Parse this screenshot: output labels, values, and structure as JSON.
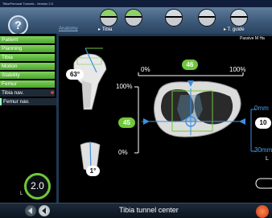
{
  "window_title": "Tibia/Femoral Tunnels - Version 2.0",
  "help_label": "?",
  "phases": [
    {
      "name": "phase-1-icon",
      "state": "done"
    },
    {
      "name": "phase-2-icon",
      "state": "done"
    },
    {
      "name": "phase-3-icon",
      "state": "pending"
    },
    {
      "name": "phase-4-icon",
      "state": "pending"
    },
    {
      "name": "phase-5-icon",
      "state": "pending"
    }
  ],
  "breadcrumbs": {
    "previous": "Anatomy",
    "current": "Tibia",
    "next": "T. guide"
  },
  "mode_label": "Passive M Ha",
  "nav": [
    {
      "label": "Patient",
      "style": "green"
    },
    {
      "label": "Planning",
      "style": "green"
    },
    {
      "label": "Tibia",
      "style": "green"
    },
    {
      "label": "Motion",
      "style": "green"
    },
    {
      "label": "Stability",
      "style": "green"
    },
    {
      "label": "Femur",
      "style": "green"
    },
    {
      "label": "Tibia nav.",
      "style": "active"
    },
    {
      "label": "Femur nav.",
      "style": "sub"
    }
  ],
  "measurements": {
    "angle_top": "63°",
    "angle_bottom": "1°",
    "pct_0_top": "0%",
    "pct_100_top": "100%",
    "pct_100_left": "100%",
    "pct_0_left": "0%",
    "ap_value": "46",
    "ml_value": "45",
    "depth_value": "10",
    "depth_top": "0mm",
    "depth_bottom": "30mm",
    "side_letter": "L"
  },
  "step_counter": "2.0",
  "step_side": "L",
  "footer_title": "Tibia tunnel center",
  "colors": {
    "green": "#6fc83b",
    "blue_indicator": "#3d8fe0",
    "frame": "#1f3853"
  }
}
